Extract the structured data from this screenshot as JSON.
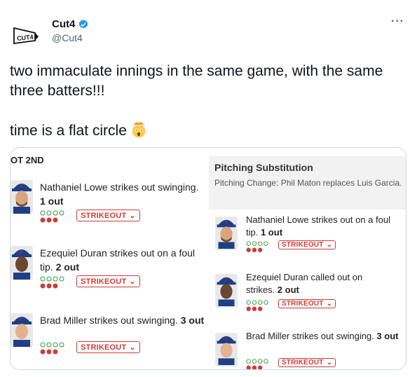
{
  "tweet": {
    "display_name": "Cut4",
    "handle": "@Cut4",
    "more_label": "···",
    "text": "two immaculate innings in the same game, with the same three batters!!!\n\ntime is a flat circle",
    "emoji": "exploding-head-emoji"
  },
  "card": {
    "title": "OT 2ND",
    "substitution": {
      "title": "Pitching Substitution",
      "text": "Pitching Change: Phil Maton replaces Luis Garcia."
    },
    "left_plays": [
      {
        "name": "Nathaniel Lowe strikes out swinging.",
        "outs": "1 out",
        "badge": "STRIKEOUT"
      },
      {
        "name": "Ezequiel Duran strikes out on a foul tip.",
        "outs": "2 out",
        "badge": "STRIKEOUT"
      },
      {
        "name": "Brad Miller strikes out swinging.",
        "outs": "3 out",
        "badge": "STRIKEOUT"
      }
    ],
    "right_plays": [
      {
        "name": "Nathaniel Lowe strikes out on a foul tip.",
        "outs": "1 out",
        "badge": "STRIKEOUT"
      },
      {
        "name": "Ezequiel Duran called out on strikes.",
        "outs": "2 out",
        "badge": "STRIKEOUT"
      },
      {
        "name": "Brad Miller strikes out swinging.",
        "outs": "3 out",
        "badge": "STRIKEOUT"
      }
    ]
  },
  "colors": {
    "verified": "#1d9bf0",
    "badge_red": "#cf3b3b",
    "rangers_blue": "#1d3f86"
  }
}
